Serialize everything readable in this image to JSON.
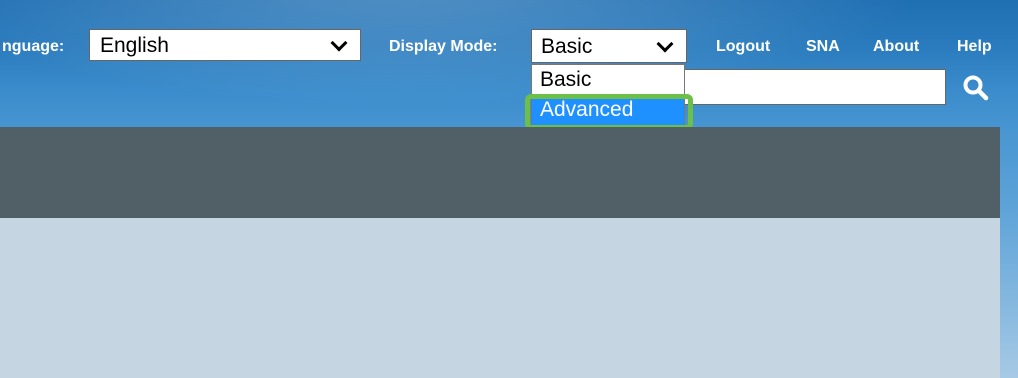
{
  "header": {
    "language_label": "nguage:",
    "language_value": "English",
    "display_mode_label": "Display Mode:",
    "display_mode_value": "Basic",
    "links": {
      "logout": "Logout",
      "sna": "SNA",
      "about": "About",
      "help": "Help"
    },
    "search": {
      "value": "",
      "icon": "search-icon"
    }
  },
  "display_mode_dropdown": {
    "options": [
      "Basic",
      "Advanced"
    ],
    "highlighted": "Advanced",
    "highlight_color": "#6cc04a",
    "selection_color": "#1e90ff"
  },
  "colors": {
    "band": "#515f66",
    "content": "#c5d5e2"
  }
}
